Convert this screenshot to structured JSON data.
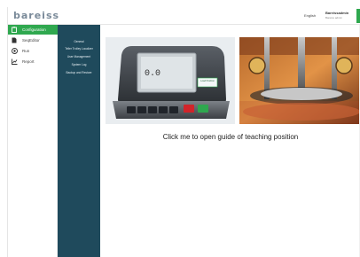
{
  "app": {
    "logo": "bareiss",
    "language": "English",
    "user_name": "Bareissadmin",
    "user_role": "Bareiss admin"
  },
  "colors": {
    "accent": "#2fa84f",
    "submenu_bg": "#1f4a5c"
  },
  "sidebar": {
    "items": [
      {
        "label": "Configuration",
        "icon": "clipboard-icon",
        "active": true
      },
      {
        "label": "SeqEditor",
        "icon": "document-icon",
        "active": false
      },
      {
        "label": "Run",
        "icon": "target-icon",
        "active": false
      },
      {
        "label": "Report",
        "icon": "chart-icon",
        "active": false
      }
    ]
  },
  "submenu": {
    "items": [
      {
        "label": "General"
      },
      {
        "label": "Teller Trolley Localizer"
      },
      {
        "label": "User Management"
      },
      {
        "label": "System Log"
      },
      {
        "label": "Backup and Restore"
      }
    ]
  },
  "content": {
    "device_display_value": "0.0",
    "device_label": "Load Position",
    "guide_link": "Click me to open guide of teaching position"
  }
}
